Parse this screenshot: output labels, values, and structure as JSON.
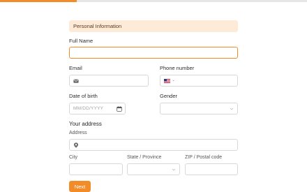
{
  "progress": {
    "value_fraction": 0.25,
    "color": "#f28c28"
  },
  "section": {
    "title": "Personal Information"
  },
  "fields": {
    "full_name": {
      "label": "Full Name",
      "value": ""
    },
    "email": {
      "label": "Email",
      "value": "",
      "icon": "envelope-icon"
    },
    "phone": {
      "label": "Phone number",
      "value": "",
      "country_flag": "us-flag-icon"
    },
    "dob": {
      "label": "Date of birth",
      "placeholder": "MM/DD/YYYY",
      "icon": "calendar-icon"
    },
    "gender": {
      "label": "Gender",
      "value": ""
    }
  },
  "address": {
    "heading": "Your address",
    "address_label": "Address",
    "address_icon": "location-pin-icon",
    "city_label": "City",
    "state_label": "State / Province",
    "zip_label": "ZIP / Postal code"
  },
  "actions": {
    "next_label": "Next"
  }
}
